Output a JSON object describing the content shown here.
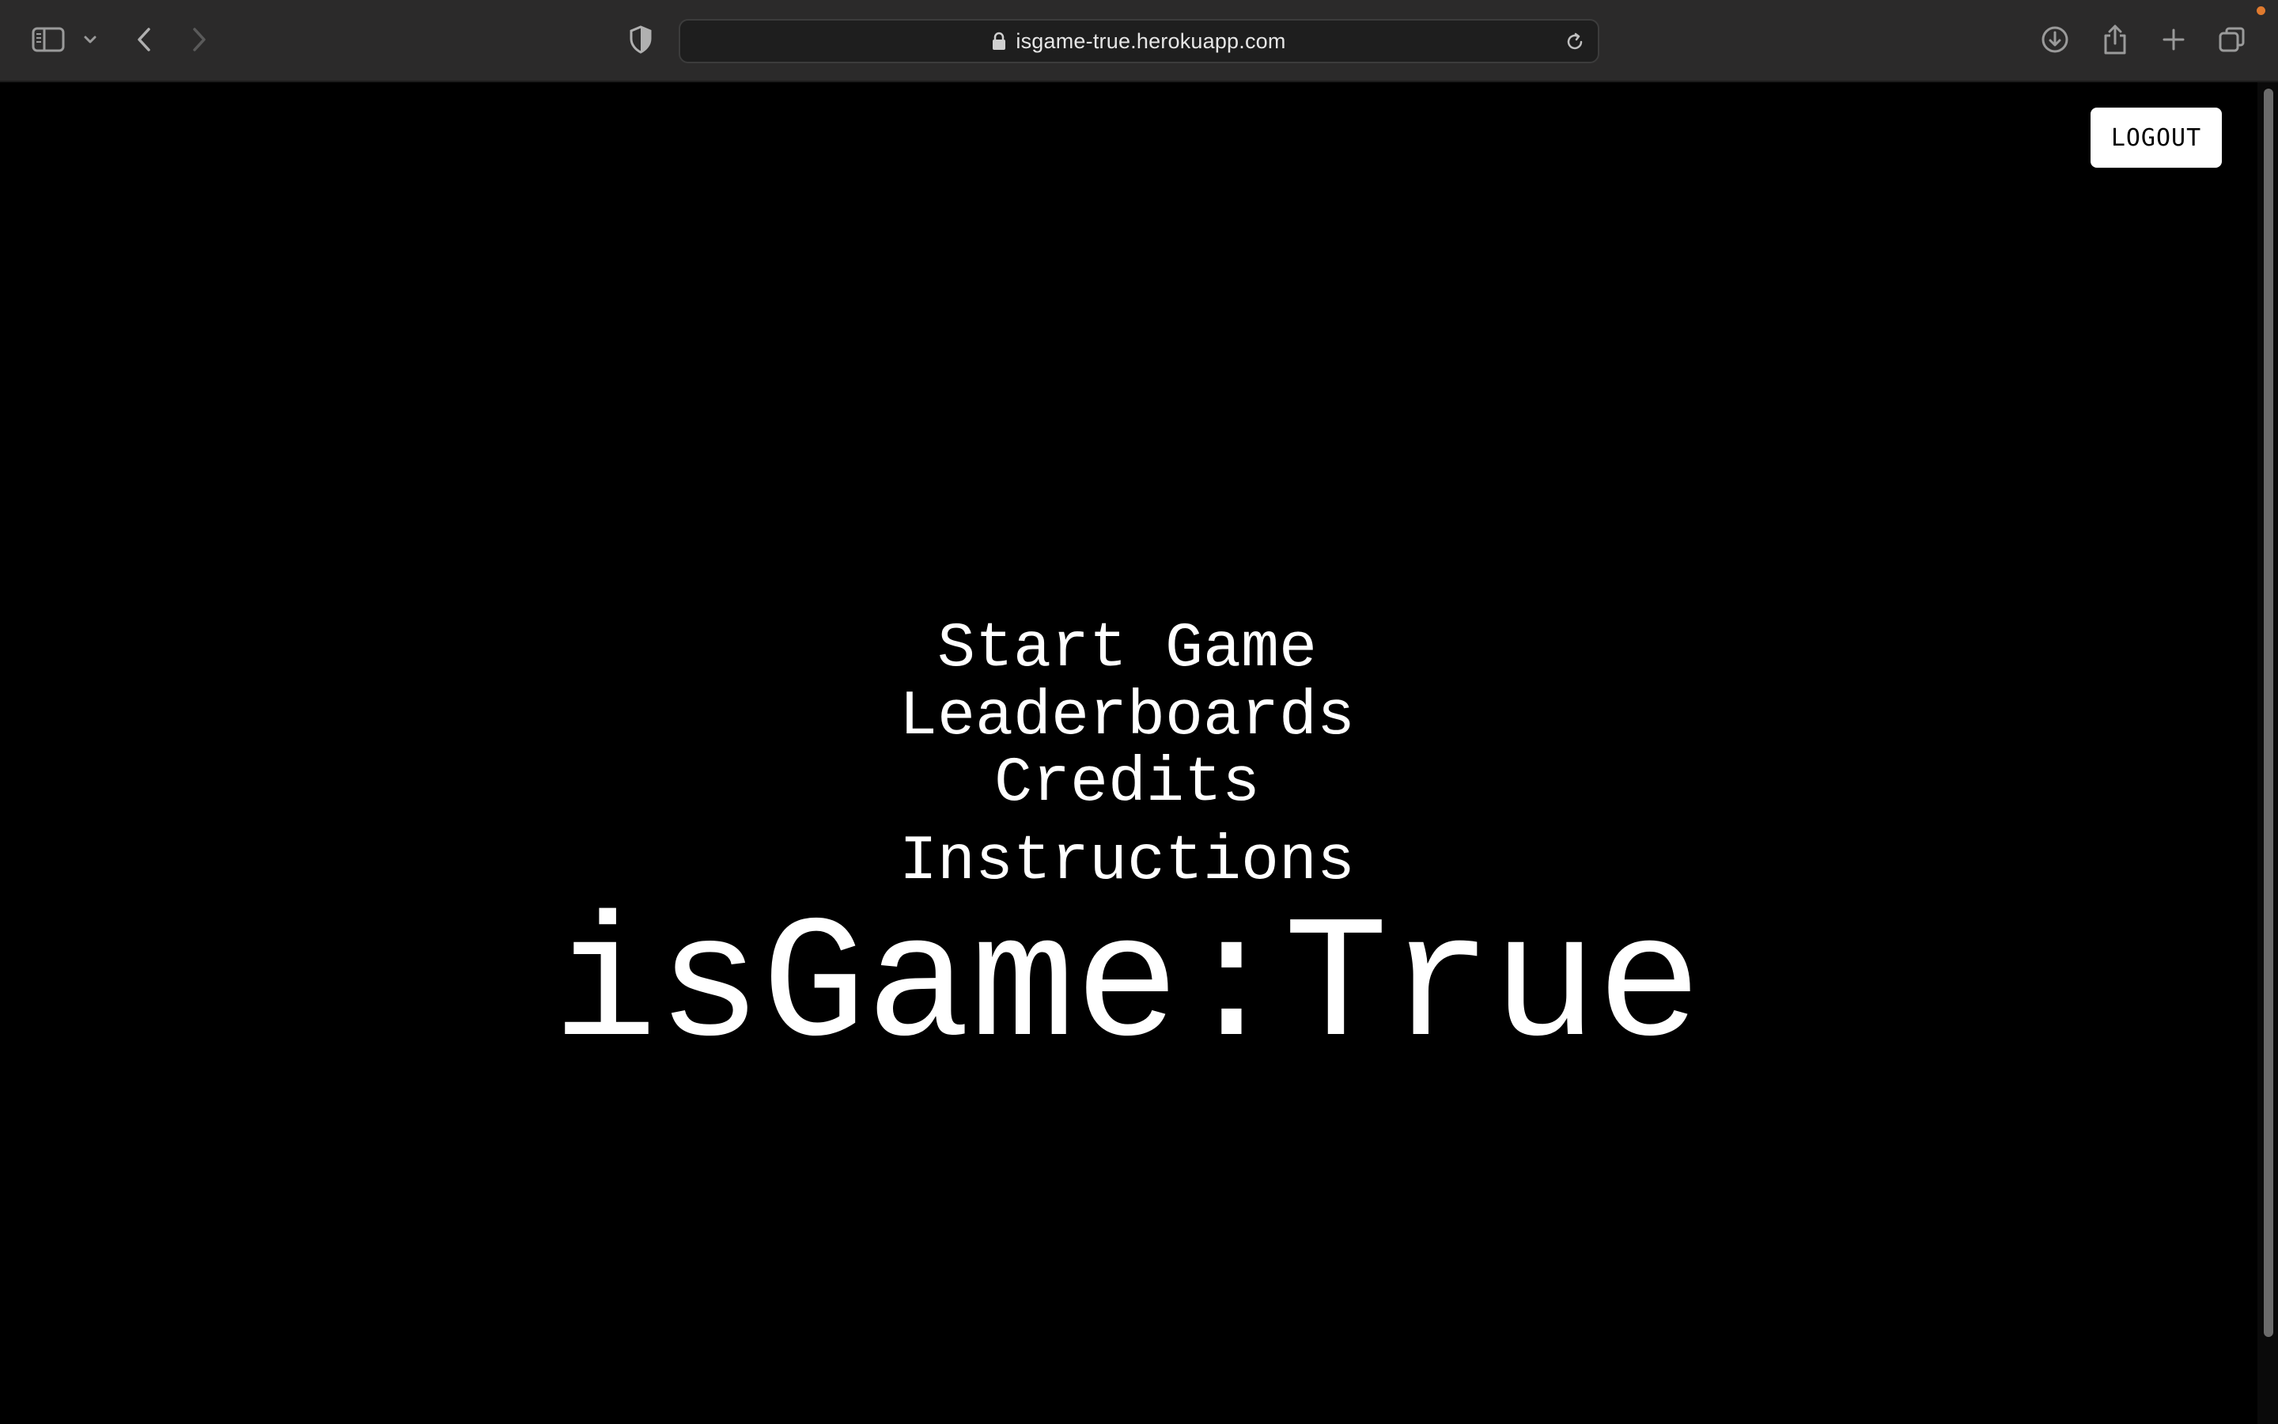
{
  "browser": {
    "url": "isgame-true.herokuapp.com",
    "icons": {
      "sidebar": "sidebar-icon",
      "sidebar_menu": "chevron-down-icon",
      "back": "chevron-left-icon",
      "forward": "chevron-right-icon",
      "privacy": "shield-icon",
      "lock": "lock-icon",
      "reload": "reload-icon",
      "downloads": "download-icon",
      "share": "share-icon",
      "new_tab": "plus-icon",
      "tab_overview": "tabs-icon"
    }
  },
  "page": {
    "logout_label": "LOGOUT",
    "menu": {
      "start": "Start Game",
      "leaderboards": "Leaderboards",
      "credits": "Credits",
      "instructions": "Instructions"
    },
    "title": "isGame:True"
  },
  "colors": {
    "background": "#000000",
    "text": "#ffffff",
    "toolbar": "#2b2a2a",
    "notification_dot": "#e07a2e"
  }
}
